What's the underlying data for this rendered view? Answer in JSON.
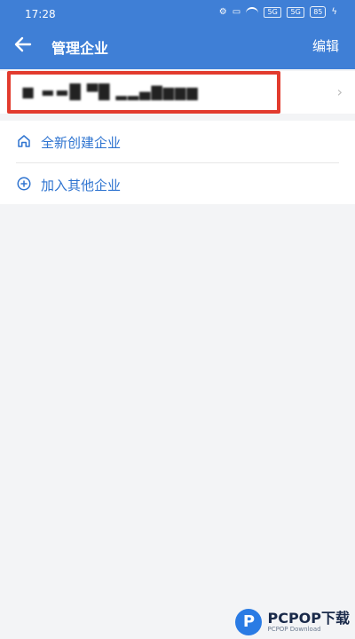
{
  "status_bar": {
    "time": "17:28",
    "signal_1": "5G",
    "signal_2": "5G",
    "battery": "85"
  },
  "app_bar": {
    "title": "管理企业",
    "edit_label": "编辑"
  },
  "org_list": {
    "items": [
      {
        "name": "■ ▬▬█ ▀█ ▂▂▄▇▆▆▆"
      }
    ]
  },
  "actions": {
    "create_label": "全新创建企业",
    "join_label": "加入其他企业"
  },
  "watermark": {
    "brand": "PCPOP下载",
    "sub": "PCPOP Download"
  },
  "colors": {
    "topbar": "#3f7fd6",
    "accent": "#2f74d0",
    "highlight": "#e23b2e"
  }
}
